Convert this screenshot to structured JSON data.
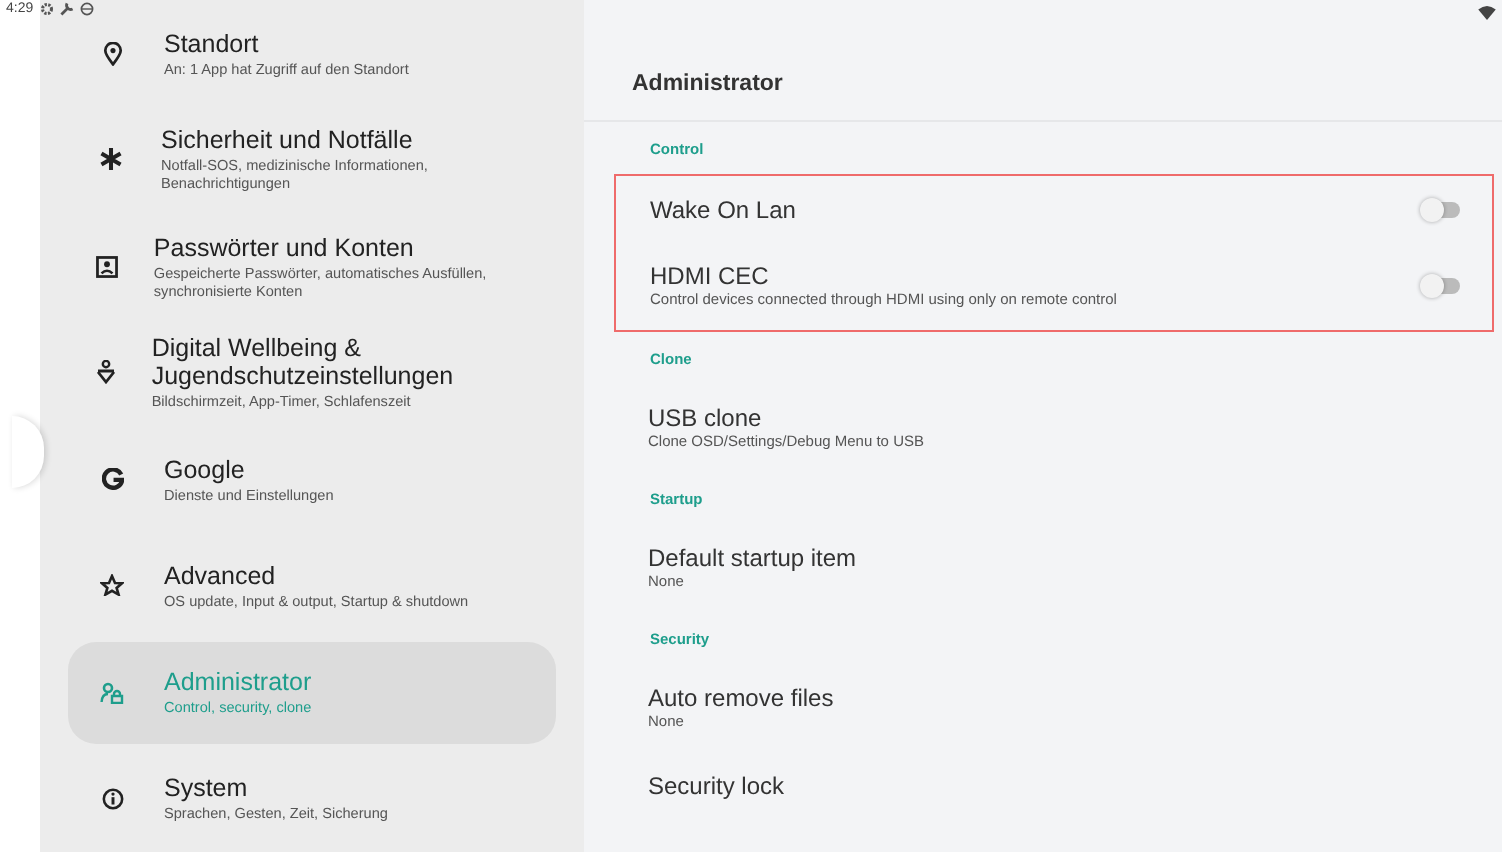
{
  "status_bar": {
    "time": "4:29"
  },
  "sidebar": {
    "items": [
      {
        "title": "Standort",
        "subtitle": "An: 1 App hat Zugriff auf den Standort",
        "selected": false
      },
      {
        "title": "Sicherheit und Notfälle",
        "subtitle": "Notfall-SOS, medizinische Informationen, Benachrichtigungen",
        "selected": false
      },
      {
        "title": "Passwörter und Konten",
        "subtitle": "Gespeicherte Passwörter, automatisches Ausfüllen, synchronisierte Konten",
        "selected": false
      },
      {
        "title": "Digital Wellbeing & Jugendschutzeinstellungen",
        "subtitle": "Bildschirmzeit, App-Timer, Schlafenszeit",
        "selected": false
      },
      {
        "title": "Google",
        "subtitle": "Dienste und Einstellungen",
        "selected": false
      },
      {
        "title": "Advanced",
        "subtitle": "OS update, Input & output, Startup & shutdown",
        "selected": false
      },
      {
        "title": "Administrator",
        "subtitle": "Control, security, clone",
        "selected": true
      },
      {
        "title": "System",
        "subtitle": "Sprachen, Gesten, Zeit, Sicherung",
        "selected": false
      }
    ]
  },
  "page": {
    "title": "Administrator",
    "sections": [
      {
        "label": "Control",
        "highlighted": true,
        "items": [
          {
            "kind": "toggle",
            "title": "Wake On Lan",
            "on": false
          },
          {
            "kind": "toggle",
            "title": "HDMI CEC",
            "subtitle": "Control devices connected through HDMI using only on remote control",
            "on": false
          }
        ]
      },
      {
        "label": "Clone",
        "highlighted": false,
        "items": [
          {
            "kind": "link",
            "title": "USB clone",
            "subtitle": "Clone OSD/Settings/Debug Menu to USB"
          }
        ]
      },
      {
        "label": "Startup",
        "highlighted": false,
        "items": [
          {
            "kind": "link",
            "title": "Default startup item",
            "subtitle": "None"
          }
        ]
      },
      {
        "label": "Security",
        "highlighted": false,
        "items": [
          {
            "kind": "link",
            "title": "Auto remove files",
            "subtitle": "None"
          },
          {
            "kind": "link",
            "title": "Security lock"
          }
        ]
      }
    ]
  }
}
